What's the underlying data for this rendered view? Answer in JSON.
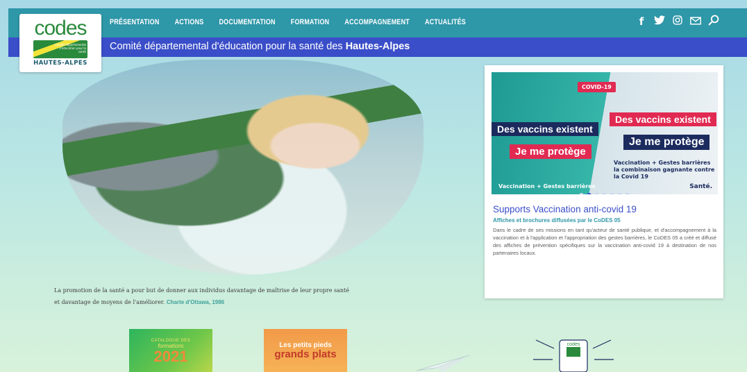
{
  "nav": {
    "items": [
      "PRÉSENTATION",
      "ACTIONS",
      "DOCUMENTATION",
      "FORMATION",
      "ACCOMPAGNEMENT",
      "ACTUALITÉS"
    ]
  },
  "social": {
    "facebook": "f",
    "twitter": "🐦",
    "instagram": "◎",
    "mail": "✉",
    "search": "⚲"
  },
  "logo": {
    "word": "codes",
    "small_text": "Comité départemental d'éducation pour la santé",
    "place": "HAUTES-ALPES"
  },
  "tagline": {
    "prefix": "Comité départemental d'éducation pour la santé des ",
    "strong": "Hautes-Alpes"
  },
  "quote": {
    "text": "La promotion de la santé a pour but de donner aux individus davantage de maîtrise de leur propre santé et davantage de moyens de l'améliorer.",
    "ref": "Charte d'Ottawa, 1986"
  },
  "card": {
    "slide": {
      "covid_label": "COVID-19",
      "left_band_1": "Des vaccins existent",
      "left_band_2": "Je me protège",
      "right_band_1": "Des vaccins existent",
      "right_band_2": "Je me protège",
      "right_small": "Vaccination + Gestes barrières\nla combinaison gagnante contre la Covid 19",
      "left_small": "Vaccination + Gestes barrières",
      "brand": "Santé."
    },
    "dots": {
      "count": 7,
      "active": 1
    },
    "title": "Supports Vaccination anti-covid 19",
    "subtitle": "Affiches et brochures diffusées par le CoDES 05",
    "body": "Dans le cadre de ses missions en tant qu'acteur de santé publique, et d'accompagnement à la vaccination et à l'application et l'appropriation des gestes barrières, le CoDES 05 a créé et diffusé des affiches de prévention spécifiques sur la vaccination anti-covid 19 à destination de nos partenaires locaux."
  },
  "bottom": {
    "catalogue": {
      "line1": "CATALOGUE DES",
      "line2": "formations",
      "year": "2021"
    },
    "pieds": {
      "line1": "Les petits pieds",
      "line2": "grands plats"
    },
    "hand_logo": "codes"
  },
  "colors": {
    "topbar": "#2e97a8",
    "subbar": "#3a4ec9",
    "accent_red": "#e12a52",
    "navy": "#1b2b5e"
  }
}
